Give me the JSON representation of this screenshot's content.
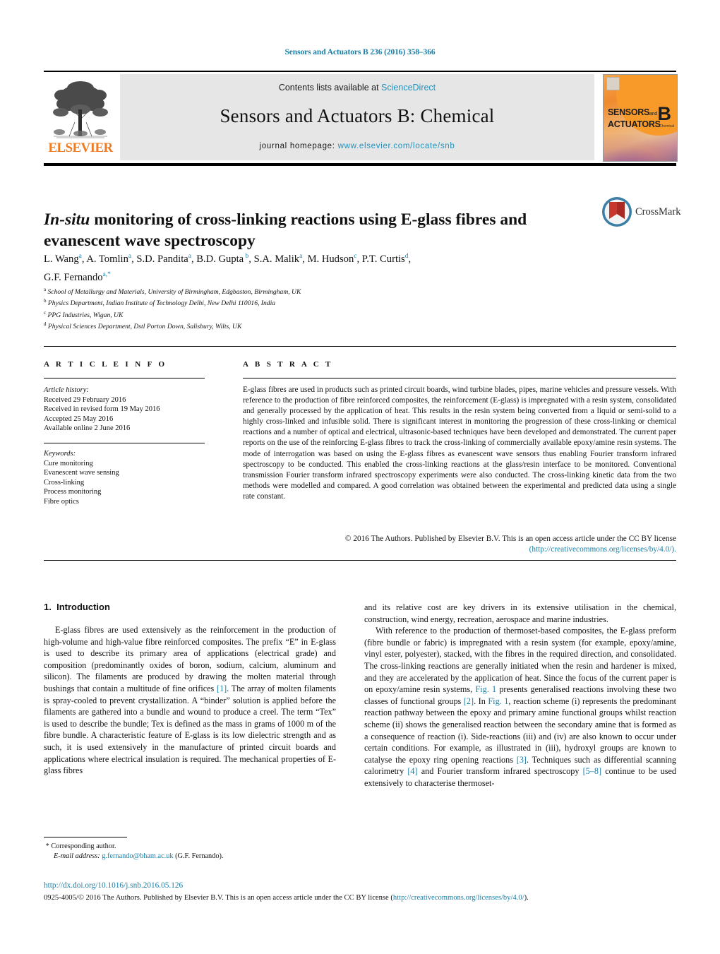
{
  "running_head": "Sensors and Actuators B 236 (2016) 358–366",
  "masthead": {
    "publisher_name": "ELSEVIER",
    "contents_prefix": "Contents lists available at",
    "sciencedirect": "ScienceDirect",
    "journal_title": "Sensors and Actuators B: Chemical",
    "homepage_label": "journal homepage:",
    "homepage_url": "www.elsevier.com/locate/snb",
    "cover": {
      "line1": "SENSORS",
      "line1_sm": "and",
      "line2": "ACTUATORS",
      "letter": "B",
      "letter_sub": "Chemical"
    }
  },
  "article": {
    "title_italic": "In-situ",
    "title_rest": " monitoring of cross-linking reactions using E-glass fibres and evanescent wave spectroscopy",
    "crossmark_label": "CrossMark",
    "authors": [
      {
        "name": "L. Wang",
        "sup": "a"
      },
      {
        "name": "A. Tomlin",
        "sup": "a"
      },
      {
        "name": "S.D. Pandita",
        "sup": "a"
      },
      {
        "name": "B.D. Gupta",
        "sup": "b"
      },
      {
        "name": "S.A. Malik",
        "sup": "a"
      },
      {
        "name": "M. Hudson",
        "sup": "c"
      },
      {
        "name": "P.T. Curtis",
        "sup": "d"
      },
      {
        "name": "G.F. Fernando",
        "sup": "a,*"
      }
    ],
    "affiliations": [
      {
        "mark": "a",
        "text": "School of Metallurgy and Materials, University of Birmingham, Edgbaston, Birmingham, UK"
      },
      {
        "mark": "b",
        "text": "Physics Department, Indian Institute of Technology Delhi, New Delhi 110016, India"
      },
      {
        "mark": "c",
        "text": "PPG Industries, Wigan, UK"
      },
      {
        "mark": "d",
        "text": "Physical Sciences Department, Dstl Porton Down, Salisbury, Wilts, UK"
      }
    ]
  },
  "article_info": {
    "heading": "A R T I C L E   I N F O",
    "history_label": "Article history:",
    "history": [
      "Received 29 February 2016",
      "Received in revised form 19 May 2016",
      "Accepted 25 May 2016",
      "Available online 2 June 2016"
    ],
    "keywords_label": "Keywords:",
    "keywords": [
      "Cure monitoring",
      "Evanescent wave sensing",
      "Cross-linking",
      "Process monitoring",
      "Fibre optics"
    ]
  },
  "abstract": {
    "heading": "A B S T R A C T",
    "body": "E-glass fibres are used in products such as printed circuit boards, wind turbine blades, pipes, marine vehicles and pressure vessels. With reference to the production of fibre reinforced composites, the reinforcement (E-glass) is impregnated with a resin system, consolidated and generally processed by the application of heat. This results in the resin system being converted from a liquid or semi-solid to a highly cross-linked and infusible solid. There is significant interest in monitoring the progression of these cross-linking or chemical reactions and a number of optical and electrical, ultrasonic-based techniques have been developed and demonstrated. The current paper reports on the use of the reinforcing E-glass fibres to track the cross-linking of commercially available epoxy/amine resin systems. The mode of interrogation was based on using the E-glass fibres as evanescent wave sensors thus enabling Fourier transform infrared spectroscopy to be conducted. This enabled the cross-linking reactions at the glass/resin interface to be monitored. Conventional transmission Fourier transform infrared spectroscopy experiments were also conducted. The cross-linking kinetic data from the two methods were modelled and compared. A good correlation was obtained between the experimental and predicted data using a single rate constant.",
    "copyright": "© 2016 The Authors. Published by Elsevier B.V. This is an open access article under the CC BY license",
    "license_url": "(http://creativecommons.org/licenses/by/4.0/)."
  },
  "body": {
    "section_number": "1.",
    "section_title": "Introduction",
    "left_paragraph_1": "E-glass fibres are used extensively as the reinforcement in the production of high-volume and high-value fibre reinforced composites. The prefix “E” in E-glass is used to describe its primary area of applications (electrical grade) and composition (predominantly oxides of boron, sodium, calcium, aluminum and silicon). The filaments are produced by drawing the molten material through bushings that contain a multitude of fine orifices ",
    "left_ref_1": "[1]",
    "left_paragraph_1b": ". The array of molten filaments is spray-cooled to prevent crystallization. A “binder” solution is applied before the filaments are gathered into a bundle and wound to produce a creel. The term “Tex” is used to describe the bundle; Tex is defined as the mass in grams of 1000 m of the fibre bundle. A characteristic feature of E-glass is its low dielectric strength and as such, it is used extensively in the manufacture of printed circuit boards and applications where electrical insulation is required. The mechanical properties of E-glass fibres",
    "right_paragraph_1": "and its relative cost are key drivers in its extensive utilisation in the chemical, construction, wind energy, recreation, aerospace and marine industries.",
    "right_paragraph_2a": "With reference to the production of thermoset-based composites, the E-glass preform (fibre bundle or fabric) is impregnated with a resin system (for example, epoxy/amine, vinyl ester, polyester), stacked, with the fibres in the required direction, and consolidated. The cross-linking reactions are generally initiated when the resin and hardener is mixed, and they are accelerated by the application of heat. Since the focus of the current paper is on epoxy/amine resin systems, ",
    "right_ref_fig1a": "Fig. 1",
    "right_paragraph_2b": " presents generalised reactions involving these two classes of functional groups ",
    "right_ref_2": "[2]",
    "right_paragraph_2c": ". In ",
    "right_ref_fig1b": "Fig. 1",
    "right_paragraph_2d": ", reaction scheme (i) represents the predominant reaction pathway between the epoxy and primary amine functional groups whilst reaction scheme (ii) shows the generalised reaction between the secondary amine that is formed as a consequence of reaction (i). Side-reactions (iii) and (iv) are also known to occur under certain conditions. For example, as illustrated in (iii), hydroxyl groups are known to catalyse the epoxy ring opening reactions ",
    "right_ref_3": "[3]",
    "right_paragraph_2e": ". Techniques such as differential scanning calorimetry ",
    "right_ref_4": "[4]",
    "right_paragraph_2f": " and Fourier transform infrared spectroscopy ",
    "right_ref_58": "[5–8]",
    "right_paragraph_2g": " continue to be used extensively to characterise thermoset-"
  },
  "footnote": {
    "star": "*",
    "corresponding": "Corresponding author.",
    "email_label": "E-mail address:",
    "email": "g.fernando@bham.ac.uk",
    "email_owner": "(G.F. Fernando)."
  },
  "page_footer": {
    "doi": "http://dx.doi.org/10.1016/j.snb.2016.05.126",
    "issn_copy": "0925-4005/© 2016 The Authors. Published by Elsevier B.V. This is an open access article under the CC BY license (",
    "license_url": "http://creativecommons.org/licenses/by/4.0/",
    "tail": ")."
  },
  "colors": {
    "link": "#1b7ea6",
    "sciencedirect": "#2092bd",
    "elsevier_orange": "#ef7c22",
    "banner_bg": "#e6e6e6"
  }
}
